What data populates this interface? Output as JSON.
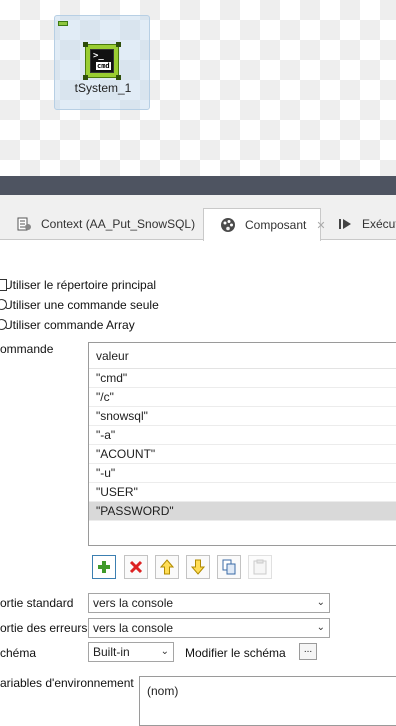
{
  "canvas": {
    "component_label": "tSystem_1",
    "icon_prompt": ">_",
    "icon_text": "cmd"
  },
  "tabs": [
    {
      "label": "Context (AA_Put_SnowSQL)",
      "icon": "context-icon",
      "active": false
    },
    {
      "label": "Composant",
      "icon": "palette-icon",
      "active": true,
      "close": "✕"
    },
    {
      "label": "Exécuto",
      "icon": "run-icon",
      "active": false
    }
  ],
  "options": {
    "use_home_dir": "Utiliser le répertoire principal",
    "single_command": "Utiliser une commande seule",
    "array_command": "Utiliser commande Array"
  },
  "command": {
    "label": "ommande",
    "column_header": "valeur",
    "rows": [
      "\"cmd\"",
      "\"/c\"",
      "\"snowsql\"",
      "\"-a\"",
      "\"ACOUNT\"",
      "\"-u\"",
      "\"USER\"",
      "\"PASSWORD\""
    ],
    "selected_row": 7
  },
  "stdout": {
    "label": "ortie standard",
    "value": "vers la console"
  },
  "stderr": {
    "label": "ortie des erreurs",
    "value": "vers la console"
  },
  "schema": {
    "label": "chéma",
    "value": "Built-in",
    "edit_label": "Modifier le schéma",
    "edit_btn": "..."
  },
  "env": {
    "label": "ariables d'environnement",
    "column_header": "(nom)"
  },
  "colors": {
    "accent": "#3c7fb1",
    "divider": "#4e5461",
    "selected_row": "#d9d9d9"
  }
}
